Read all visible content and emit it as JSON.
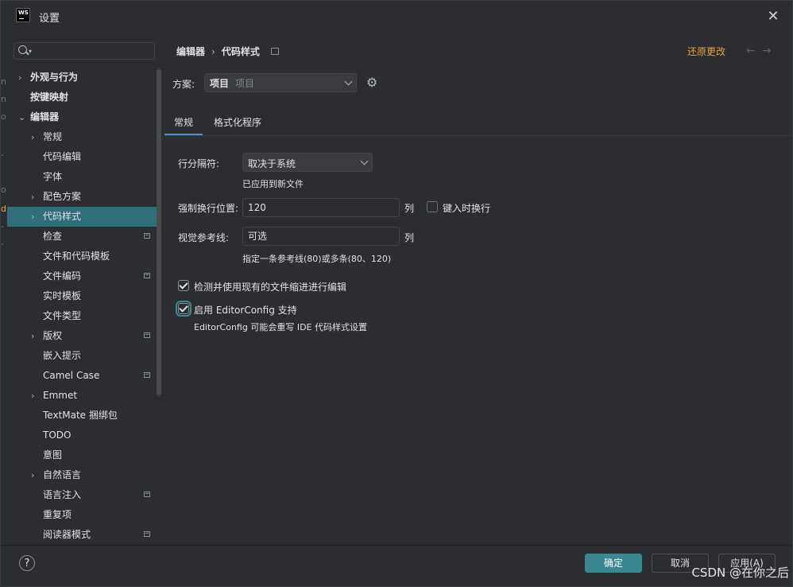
{
  "window": {
    "title": "设置",
    "app_logo_text": "WS"
  },
  "sidebar": {
    "search_placeholder": "",
    "items": [
      {
        "label": "外观与行为",
        "bold": true,
        "expandable": true
      },
      {
        "label": "按键映射",
        "bold": true,
        "expandable": false
      },
      {
        "label": "编辑器",
        "bold": true,
        "expanded": true
      },
      {
        "label": "常规",
        "expandable": true
      },
      {
        "label": "代码编辑"
      },
      {
        "label": "字体"
      },
      {
        "label": "配色方案",
        "expandable": true
      },
      {
        "label": "代码样式",
        "expandable": true,
        "selected": true
      },
      {
        "label": "检查",
        "project_icon": true
      },
      {
        "label": "文件和代码模板"
      },
      {
        "label": "文件编码",
        "project_icon": true
      },
      {
        "label": "实时模板"
      },
      {
        "label": "文件类型"
      },
      {
        "label": "版权",
        "expandable": true,
        "project_icon": true
      },
      {
        "label": "嵌入提示"
      },
      {
        "label": "Camel Case",
        "project_icon": true
      },
      {
        "label": "Emmet",
        "expandable": true
      },
      {
        "label": "TextMate 捆绑包"
      },
      {
        "label": "TODO"
      },
      {
        "label": "意图"
      },
      {
        "label": "自然语言",
        "expandable": true
      },
      {
        "label": "语言注入",
        "project_icon": true
      },
      {
        "label": "重复项"
      },
      {
        "label": "阅读器模式",
        "project_icon": true
      }
    ]
  },
  "header": {
    "breadcrumb": [
      "编辑器",
      "代码样式"
    ],
    "reset_link": "还原更改"
  },
  "scheme": {
    "label": "方案:",
    "value": "项目",
    "sub": "项目"
  },
  "tabs": [
    {
      "label": "常规",
      "active": true
    },
    {
      "label": "格式化程序",
      "active": false
    }
  ],
  "general": {
    "line_separator_label": "行分隔符:",
    "line_separator_value": "取决于系统",
    "line_separator_hint": "已应用到新文件",
    "hard_wrap_label": "强制换行位置:",
    "hard_wrap_value": "120",
    "hard_wrap_unit": "列",
    "wrap_on_typing_label": "键入时换行",
    "wrap_on_typing_checked": false,
    "visual_guides_label": "视觉参考线:",
    "visual_guides_placeholder": "可选",
    "visual_guides_unit": "列",
    "visual_guides_hint": "指定一条参考线(80)或多条(80、120)",
    "detect_indent_label": "检测并使用现有的文件缩进进行编辑",
    "detect_indent_checked": true,
    "editorconfig_label": "启用 EditorConfig 支持",
    "editorconfig_checked": true,
    "editorconfig_hint": "EditorConfig 可能会重写 IDE 代码样式设置"
  },
  "footer": {
    "help": "?",
    "ok": "确定",
    "cancel": "取消",
    "apply": "应用(A)"
  },
  "watermark": "CSDN @在你之后",
  "colors": {
    "accent_teal": "#3a8890",
    "reset_orange": "#e8a33d",
    "background": "#2b2d30"
  }
}
